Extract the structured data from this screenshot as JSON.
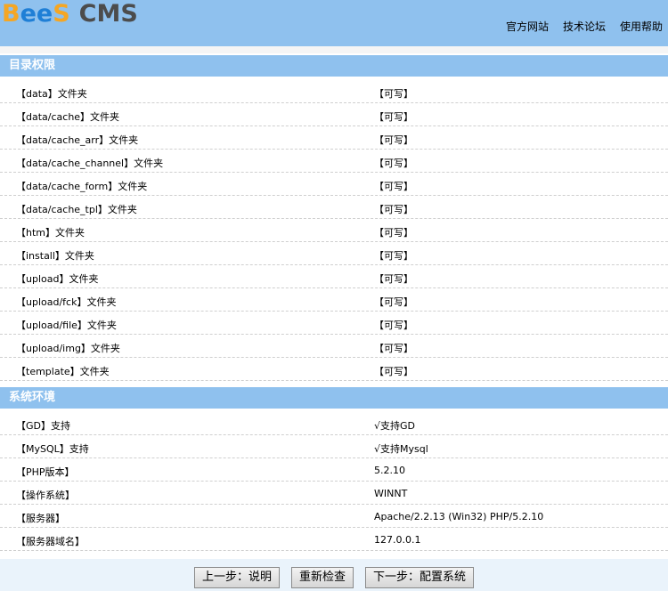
{
  "logo": {
    "letters": [
      "B",
      "e",
      "e",
      "S"
    ],
    "suffix": "CMS",
    "colors": {
      "b": "#f5a623",
      "e": "#1f7fd6",
      "s": "#f5a623",
      "cms": "#4c4c4c"
    }
  },
  "topnav": {
    "items": [
      "官方网站",
      "技术论坛",
      "使用帮助"
    ]
  },
  "colors": {
    "header_bg": "#8fc1ee",
    "section_bg": "#8fc1ee",
    "footer_bg": "#eaf3fb"
  },
  "sections": [
    {
      "title": "目录权限",
      "rows": [
        {
          "name": "【data】文件夹",
          "value": "【可写】"
        },
        {
          "name": "【data/cache】文件夹",
          "value": "【可写】"
        },
        {
          "name": "【data/cache_arr】文件夹",
          "value": "【可写】"
        },
        {
          "name": "【data/cache_channel】文件夹",
          "value": "【可写】"
        },
        {
          "name": "【data/cache_form】文件夹",
          "value": "【可写】"
        },
        {
          "name": "【data/cache_tpl】文件夹",
          "value": "【可写】"
        },
        {
          "name": "【htm】文件夹",
          "value": "【可写】"
        },
        {
          "name": "【install】文件夹",
          "value": "【可写】"
        },
        {
          "name": "【upload】文件夹",
          "value": "【可写】"
        },
        {
          "name": "【upload/fck】文件夹",
          "value": "【可写】"
        },
        {
          "name": "【upload/file】文件夹",
          "value": "【可写】"
        },
        {
          "name": "【upload/img】文件夹",
          "value": "【可写】"
        },
        {
          "name": "【template】文件夹",
          "value": "【可写】"
        }
      ]
    },
    {
      "title": "系统环境",
      "rows": [
        {
          "name": "【GD】支持",
          "value": "√支持GD"
        },
        {
          "name": "【MySQL】支持",
          "value": "√支持Mysql"
        },
        {
          "name": "【PHP版本】",
          "value": "5.2.10"
        },
        {
          "name": "【操作系统】",
          "value": "WINNT"
        },
        {
          "name": "【服务器】",
          "value": "Apache/2.2.13 (Win32) PHP/5.2.10"
        },
        {
          "name": "【服务器域名】",
          "value": "127.0.0.1"
        }
      ]
    }
  ],
  "buttons": {
    "prev": "上一步：说明",
    "recheck": "重新检查",
    "next": "下一步：配置系统"
  }
}
